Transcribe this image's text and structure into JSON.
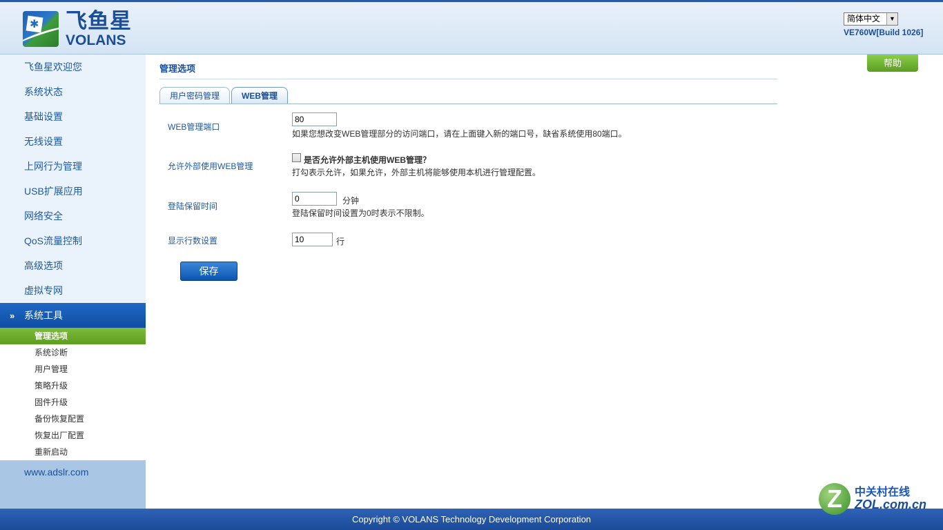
{
  "header": {
    "brand_cn": "飞鱼星",
    "brand_en": "VOLANS",
    "language": "简体中文",
    "build": "VE760W[Build 1026]"
  },
  "sidebar": {
    "items": [
      {
        "label": "飞鱼星欢迎您"
      },
      {
        "label": "系统状态"
      },
      {
        "label": "基础设置"
      },
      {
        "label": "无线设置"
      },
      {
        "label": "上网行为管理"
      },
      {
        "label": "USB扩展应用"
      },
      {
        "label": "网络安全"
      },
      {
        "label": "QoS流量控制"
      },
      {
        "label": "高级选项"
      },
      {
        "label": "虚拟专网"
      }
    ],
    "active_group": "系统工具",
    "sub_items": [
      {
        "label": "管理选项",
        "selected": true
      },
      {
        "label": "系统诊断"
      },
      {
        "label": "用户管理"
      },
      {
        "label": "策略升级"
      },
      {
        "label": "固件升级"
      },
      {
        "label": "备份恢复配置"
      },
      {
        "label": "恢复出厂配置"
      },
      {
        "label": "重新启动"
      }
    ],
    "footer_link": "www.adslr.com"
  },
  "main": {
    "title": "管理选项",
    "help": "帮助",
    "tabs": [
      {
        "label": "用户密码管理",
        "active": false
      },
      {
        "label": "WEB管理",
        "active": true
      }
    ],
    "form": {
      "web_port": {
        "label": "WEB管理端口",
        "value": "80",
        "hint": "如果您想改变WEB管理部分的访问端口，请在上面键入新的端口号，缺省系统使用80端口。"
      },
      "external": {
        "label": "允许外部使用WEB管理",
        "checkbox_label": "是否允许外部主机使用WEB管理？",
        "checked": false,
        "hint": "打勾表示允许，如果允许，外部主机将能够使用本机进行管理配置。"
      },
      "login_time": {
        "label": "登陆保留时间",
        "value": "0",
        "unit": "分钟",
        "hint": "登陆保留时间设置为0时表示不限制。"
      },
      "rows": {
        "label": "显示行数设置",
        "value": "10",
        "unit": "行"
      }
    },
    "save": "保存"
  },
  "footer": {
    "copyright": "Copyright © VOLANS Technology Development Corporation"
  },
  "watermark": {
    "cn": "中关村在线",
    "en": "ZOL.com.cn",
    "mark": "Z"
  },
  "colors": {
    "brand_blue": "#1c4e98",
    "nav_active": "#1f68c4",
    "sub_selected": "#6aaa2c",
    "help_green": "#6fb335"
  }
}
